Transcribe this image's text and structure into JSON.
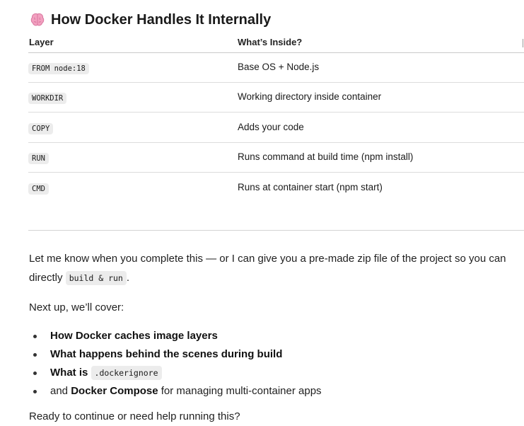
{
  "heading": {
    "icon": "brain-icon",
    "title": "How Docker Handles It Internally"
  },
  "table": {
    "headers": [
      "Layer",
      "What’s Inside?"
    ],
    "rows": [
      {
        "layer": "FROM node:18",
        "inside": "Base OS + Node.js"
      },
      {
        "layer": "WORKDIR",
        "inside": "Working directory inside container"
      },
      {
        "layer": "COPY",
        "inside": "Adds your code"
      },
      {
        "layer": "RUN",
        "inside": "Runs command at build time (npm install)"
      },
      {
        "layer": "CMD",
        "inside": "Runs at container start (npm start)"
      }
    ]
  },
  "message": {
    "line1": "Let me know when you complete this — or I can give you a pre-made zip file of the project so you can",
    "line2_prefix": "directly",
    "line2_code": "build & run",
    "line2_suffix": ".",
    "next_up": "Next up, we’ll cover:",
    "bullets": {
      "b1": "How Docker caches image layers",
      "b2": "What happens behind the scenes during build",
      "b3_bold": "What is",
      "b3_code": ".dockerignore",
      "b4_prefix": "and",
      "b4_bold": "Docker Compose",
      "b4_suffix": "for managing multi-container apps"
    },
    "closing": "Ready to continue or need help running this?"
  },
  "colors": {
    "brain": "#f2a1c0",
    "brain_dark": "#d9769f",
    "code_bg": "#ececec"
  }
}
